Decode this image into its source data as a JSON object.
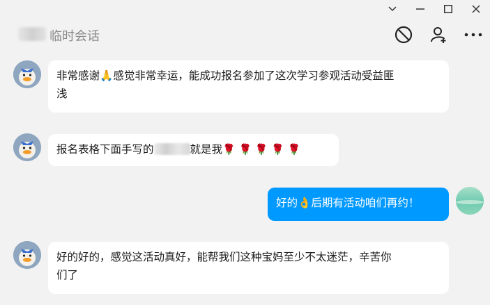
{
  "window": {
    "controls": [
      "minimize-chevron",
      "minimize",
      "maximize",
      "close"
    ]
  },
  "header": {
    "title": "临时会话",
    "icons": [
      "block-icon",
      "add-friend-icon",
      "more-icon"
    ]
  },
  "messages": [
    {
      "sender": "other",
      "before_emoji": "非常感谢",
      "emoji": "🙏",
      "after_emoji_line1": "感觉非常幸运，能成功报名参加了这次学习参观活动受益匪",
      "line2": "浅"
    },
    {
      "sender": "other",
      "before_blur": "报名表格下面手写的",
      "after_blur": "就是我",
      "roses": "🌹 🌹 🌹 🌹 🌹"
    },
    {
      "sender": "me",
      "before_emoji": "好的",
      "emoji": "👌",
      "after_emoji": "后期有活动咱们再约！"
    },
    {
      "sender": "other",
      "line1": "好的好的，感觉这活动真好，能帮我们这种宝妈至少不太迷茫，辛苦你",
      "line2": "们了"
    }
  ],
  "colors": {
    "self_bubble": "#0099ff",
    "other_bubble": "#ffffff",
    "background": "#f2f2f2"
  }
}
